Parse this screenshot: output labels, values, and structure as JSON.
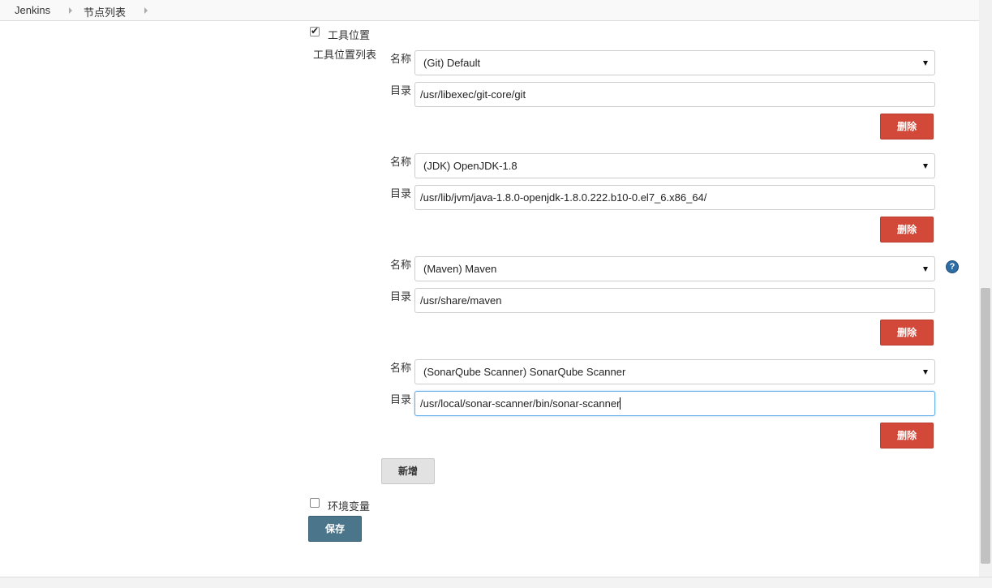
{
  "breadcrumb": {
    "items": [
      "Jenkins",
      "节点列表"
    ]
  },
  "tool_locations": {
    "checkbox_label": "工具位置",
    "checked": true,
    "list_label": "工具位置列表",
    "name_label": "名称",
    "dir_label": "目录",
    "delete_label": "删除",
    "entries": [
      {
        "name": "(Git) Default",
        "directory": "/usr/libexec/git-core/git"
      },
      {
        "name": "(JDK) OpenJDK-1.8",
        "directory": "/usr/lib/jvm/java-1.8.0-openjdk-1.8.0.222.b10-0.el7_6.x86_64/"
      },
      {
        "name": "(Maven) Maven",
        "directory": "/usr/share/maven"
      },
      {
        "name": "(SonarQube Scanner) SonarQube Scanner",
        "directory": "/usr/local/sonar-scanner/bin/sonar-scanner"
      }
    ],
    "add_label": "新增",
    "help_symbol": "?"
  },
  "env_vars": {
    "checkbox_label": "环境变量",
    "checked": false
  },
  "save_label": "保存",
  "icons": {
    "checkbox_check": "✔",
    "help": "help-icon",
    "dropdown": "caret-down-icon",
    "breadcrumb_separator": "chevron-right-icon"
  },
  "colors": {
    "delete_button": "#d24939",
    "save_button": "#4b758b",
    "add_button": "#e2e2e2",
    "help_icon": "#2e6da4",
    "focus_border": "#66afe9"
  }
}
